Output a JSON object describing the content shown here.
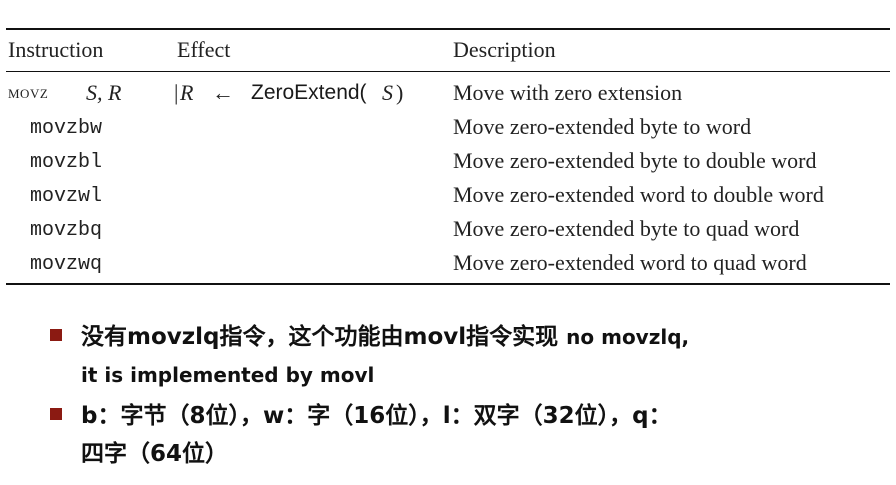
{
  "table": {
    "headers": [
      "Instruction",
      "Effect",
      "Description"
    ],
    "general": {
      "mnemonic": "movz",
      "operands": "S, R",
      "effect_bar": "|",
      "effect_dest": "R",
      "effect_arrow": "←",
      "effect_func": "ZeroExtend(",
      "effect_arg": "S",
      "effect_close": ")",
      "description": "Move with zero extension"
    },
    "rows": [
      {
        "instruction": "movzbw",
        "description": "Move zero-extended byte to word"
      },
      {
        "instruction": "movzbl",
        "description": "Move zero-extended byte to double word"
      },
      {
        "instruction": "movzwl",
        "description": "Move zero-extended word to double word"
      },
      {
        "instruction": "movzbq",
        "description": "Move zero-extended byte to quad word"
      },
      {
        "instruction": "movzwq",
        "description": "Move zero-extended word to quad word"
      }
    ]
  },
  "bullets": [
    {
      "main": "没有movzlq指令，这个功能由movl指令实现",
      "tail": "no movzlq,",
      "line2": "it is implemented by movl"
    },
    {
      "line1": "b：字节（8位），w：字（16位），l：双字（32位），q：",
      "line2": "四字（64位）"
    }
  ],
  "colors": {
    "bullet": "#8b1a12",
    "rule": "#111111"
  }
}
